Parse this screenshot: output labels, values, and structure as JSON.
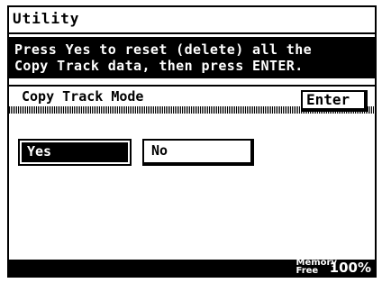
{
  "window": {
    "title": "Utility"
  },
  "message": {
    "line1": "Press Yes to reset (delete) all the",
    "line2": "Copy Track data, then press ENTER."
  },
  "mode_bar": {
    "label": "Copy Track Mode",
    "enter_label": "Enter"
  },
  "choices": {
    "yes_label": "Yes",
    "no_label": "No",
    "selected": "Yes"
  },
  "footer": {
    "memory_label_line1": "Memory",
    "memory_label_line2": "Free",
    "memory_value": "100%"
  },
  "colors": {
    "foreground": "#000000",
    "background": "#ffffff"
  }
}
